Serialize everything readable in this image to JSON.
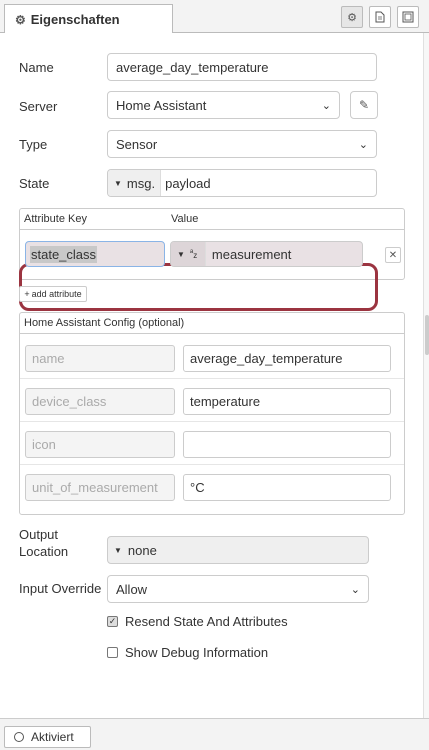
{
  "tab": {
    "title": "Eigenschaften",
    "icon": "gear-icon"
  },
  "toolbar": {
    "settings_icon": "gear-icon",
    "description_icon": "document-icon",
    "appearance_icon": "layout-icon"
  },
  "form": {
    "name_label": "Name",
    "name_value": "average_day_temperature",
    "server_label": "Server",
    "server_value": "Home Assistant",
    "type_label": "Type",
    "type_value": "Sensor",
    "state_label": "State",
    "state_type": "msg.",
    "state_value": "payload"
  },
  "attributes": {
    "key_header": "Attribute Key",
    "value_header": "Value",
    "row_key": "state_class",
    "row_type": "a z",
    "row_value": "measurement",
    "add_label": "add attribute",
    "highlight_color": "#9b3440"
  },
  "ha_config": {
    "title": "Home Assistant Config (optional)",
    "rows": [
      {
        "key": "name",
        "value": "average_day_temperature"
      },
      {
        "key": "device_class",
        "value": "temperature"
      },
      {
        "key": "icon",
        "value": ""
      },
      {
        "key": "unit_of_measurement",
        "value": "°C"
      }
    ]
  },
  "output": {
    "label_line1": "Output",
    "label_line2": "Location",
    "value": "none"
  },
  "input_override": {
    "label": "Input Override",
    "value": "Allow"
  },
  "checks": {
    "resend": {
      "label": "Resend State And Attributes",
      "checked": true
    },
    "debug": {
      "label": "Show Debug Information",
      "checked": false
    }
  },
  "footer": {
    "enabled_label": "Aktiviert"
  }
}
